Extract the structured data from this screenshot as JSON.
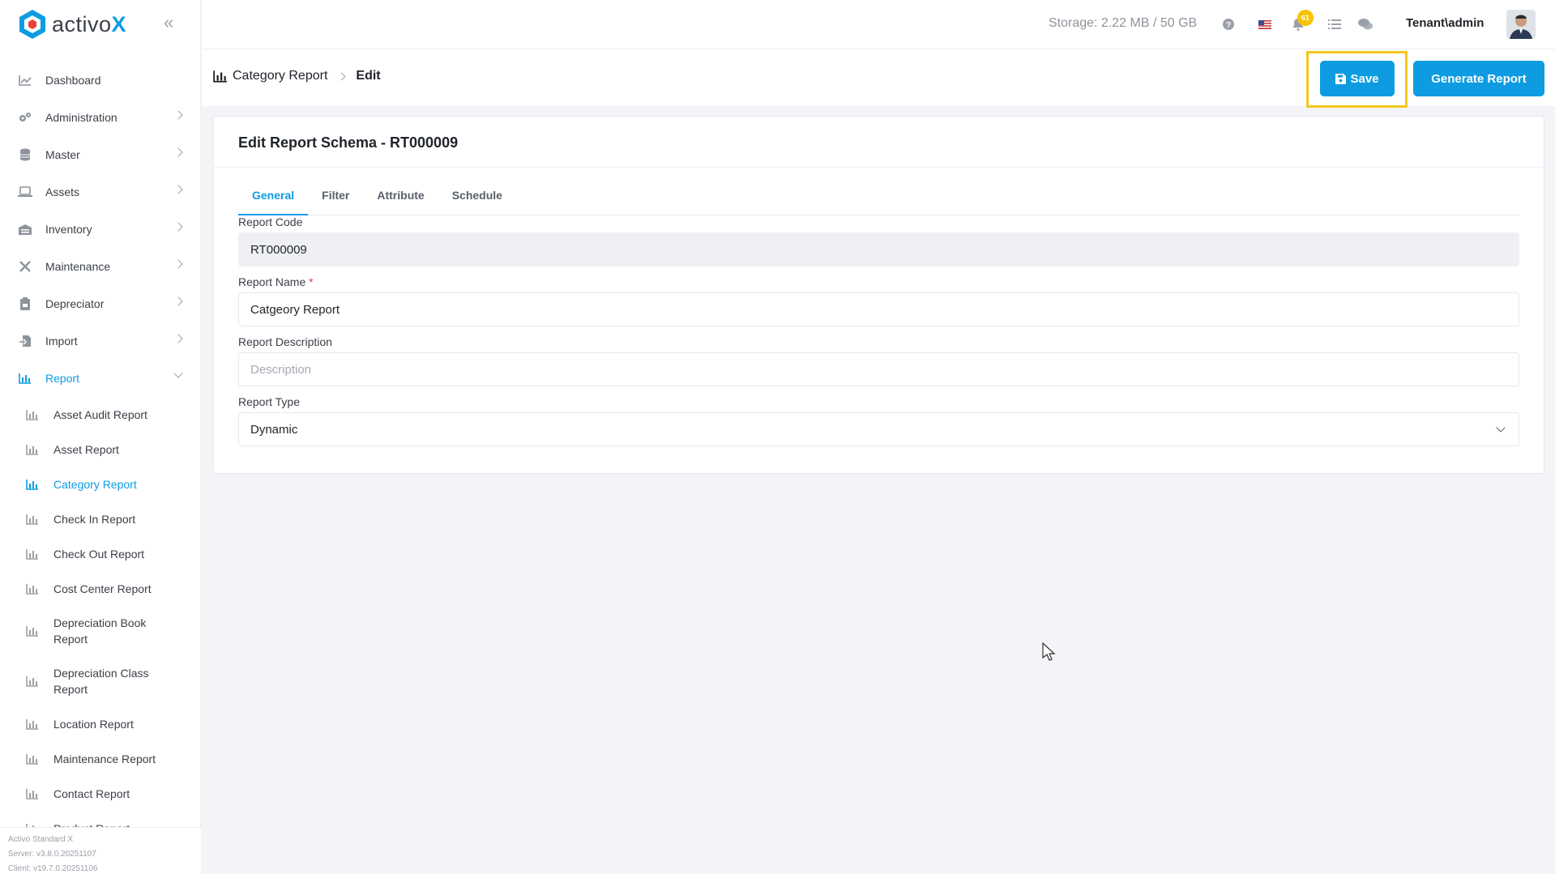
{
  "app": {
    "brand_prefix": "activo",
    "brand_suffix": "X",
    "colors": {
      "accent": "#0d9ce1",
      "highlight": "#f2c81b",
      "badge": "#f7c200"
    }
  },
  "sidebar": {
    "items": [
      {
        "label": "Dashboard",
        "icon": "chart-line-icon"
      },
      {
        "label": "Administration",
        "icon": "cogs-icon"
      },
      {
        "label": "Master",
        "icon": "database-icon"
      },
      {
        "label": "Assets",
        "icon": "laptop-icon"
      },
      {
        "label": "Inventory",
        "icon": "warehouse-icon"
      },
      {
        "label": "Maintenance",
        "icon": "tools-icon"
      },
      {
        "label": "Depreciator",
        "icon": "clipboard-icon"
      },
      {
        "label": "Import",
        "icon": "file-import-icon"
      },
      {
        "label": "Report",
        "icon": "bar-chart-icon"
      }
    ],
    "report_sub": [
      "Asset Audit Report",
      "Asset Report",
      "Category Report",
      "Check In Report",
      "Check Out Report",
      "Cost Center Report",
      "Depreciation Book Report",
      "Depreciation Class Report",
      "Location Report",
      "Maintenance Report",
      "Contact Report",
      "Product Report"
    ],
    "footer": {
      "product": "Activo Standard X",
      "server": "Server: v3.8.0.20251107",
      "client": "Client: v19.7.0.20251106"
    }
  },
  "topbar": {
    "storage": "Storage: 2.22 MB / 50 GB",
    "notification_count": "61",
    "user": "Tenant\\admin"
  },
  "subheader": {
    "breadcrumb_parent": "Category Report",
    "breadcrumb_current": "Edit",
    "save_label": "Save",
    "generate_label": "Generate Report"
  },
  "card": {
    "title": "Edit Report Schema - RT000009",
    "tabs": [
      "General",
      "Filter",
      "Attribute",
      "Schedule"
    ],
    "fields": {
      "code_label": "Report Code",
      "code_value": "RT000009",
      "name_label": "Report Name",
      "name_required": "*",
      "name_value": "Catgeory Report",
      "desc_label": "Report Description",
      "desc_placeholder": "Description",
      "type_label": "Report Type",
      "type_value": "Dynamic"
    }
  }
}
